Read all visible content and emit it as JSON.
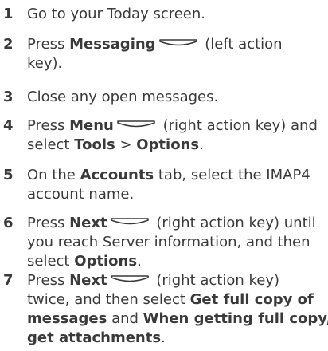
{
  "steps": [
    {
      "number": "1",
      "lines": [
        {
          "a": "Go to your Today screen."
        }
      ]
    },
    {
      "number": "2",
      "lines": [
        {
          "a": "Press ",
          "b": "Messaging",
          "c": " (left action"
        },
        {
          "a": "key)."
        }
      ],
      "key_icon": "left-action-key-icon"
    },
    {
      "number": "3",
      "lines": [
        {
          "a": "Close any open messages."
        }
      ]
    },
    {
      "number": "4",
      "lines": [
        {
          "a": "Press ",
          "b": "Menu",
          "c": " (right action key) and"
        },
        {
          "a": "select ",
          "b": "Tools",
          "c": " > ",
          "d": "Options",
          "e": "."
        }
      ],
      "key_icon": "right-action-key-icon"
    },
    {
      "number": "5",
      "lines": [
        {
          "a": "On the ",
          "b": "Accounts",
          "c": " tab, select the IMAP4"
        },
        {
          "a": "account name."
        }
      ]
    },
    {
      "number": "6",
      "lines": [
        {
          "a": "Press ",
          "b": "Next",
          "c": " (right action key) until"
        },
        {
          "a": "you reach Server information, and then"
        },
        {
          "a": "select ",
          "b": "Options",
          "c": "."
        }
      ],
      "key_icon": "right-action-key-icon"
    },
    {
      "number": "7",
      "lines": [
        {
          "a": "Press ",
          "b": "Next",
          "c": " (right action key)"
        },
        {
          "a": "twice, and then select ",
          "b": "Get full copy of"
        },
        {
          "b": "messages",
          "a": " and ",
          "c": "When getting full copy,"
        },
        {
          "b": "get attachments",
          "a": "."
        }
      ],
      "key_icon": "right-action-key-icon"
    }
  ],
  "colors": {
    "text": "#3a3a3a"
  }
}
